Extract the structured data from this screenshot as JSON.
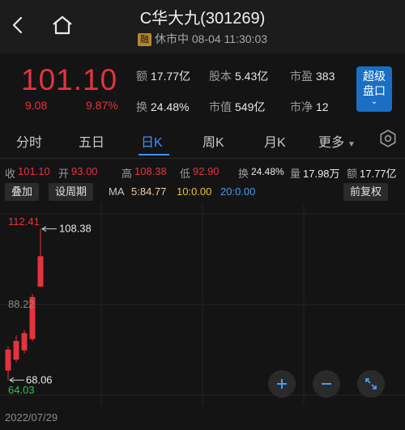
{
  "header": {
    "title": "C华大九(301269)",
    "badge": "融",
    "status": "休市中 08-04 11:30:03"
  },
  "quote": {
    "price": "101.10",
    "change": "9.08",
    "change_pct": "9.87%",
    "fields": [
      {
        "k": "额",
        "v": "17.77亿"
      },
      {
        "k": "股本",
        "v": "5.43亿"
      },
      {
        "k": "市盈",
        "v": "383"
      },
      {
        "k": "换",
        "v": "24.48%"
      },
      {
        "k": "市值",
        "v": "549亿"
      },
      {
        "k": "市净",
        "v": "12"
      }
    ],
    "super_button": {
      "line1": "超级",
      "line2": "盘口"
    }
  },
  "tabs": [
    "分时",
    "五日",
    "日K",
    "周K",
    "月K",
    "更多"
  ],
  "active_tab": "日K",
  "stats": {
    "close_label": "收",
    "close": "101.10",
    "open_label": "开",
    "open": "93.00",
    "high_label": "高",
    "high": "108.38",
    "low_label": "低",
    "low": "92.90",
    "turnover_label": "换",
    "turnover": "24.48%",
    "volume_label": "量",
    "volume": "17.98万",
    "amount_label": "额",
    "amount": "17.77亿"
  },
  "controls": {
    "overlay": "叠加",
    "set_period": "设周期",
    "ma_label": "MA",
    "ma5": "5:84.77",
    "ma10": "10:0.00",
    "ma20": "20:0.00",
    "adjust": "前复权"
  },
  "chart_data": {
    "type": "candlestick",
    "y_axis_labels": [
      "112.41",
      "88.22",
      "64.03"
    ],
    "ylim": [
      64.03,
      112.41
    ],
    "max_marker": "108.38",
    "min_marker": "68.06",
    "x_start_label": "2022/07/29",
    "candles": [
      {
        "open": 70.6,
        "close": 76.2,
        "high": 77.0,
        "low": 68.06
      },
      {
        "open": 73.5,
        "close": 78.5,
        "high": 80.0,
        "low": 72.8
      },
      {
        "open": 76.0,
        "close": 80.6,
        "high": 81.4,
        "low": 75.2
      },
      {
        "open": 79.0,
        "close": 90.2,
        "high": 91.0,
        "low": 78.4
      },
      {
        "open": 93.0,
        "close": 101.1,
        "high": 108.38,
        "low": 92.9
      }
    ],
    "colors": {
      "up": "#e3343e"
    }
  }
}
